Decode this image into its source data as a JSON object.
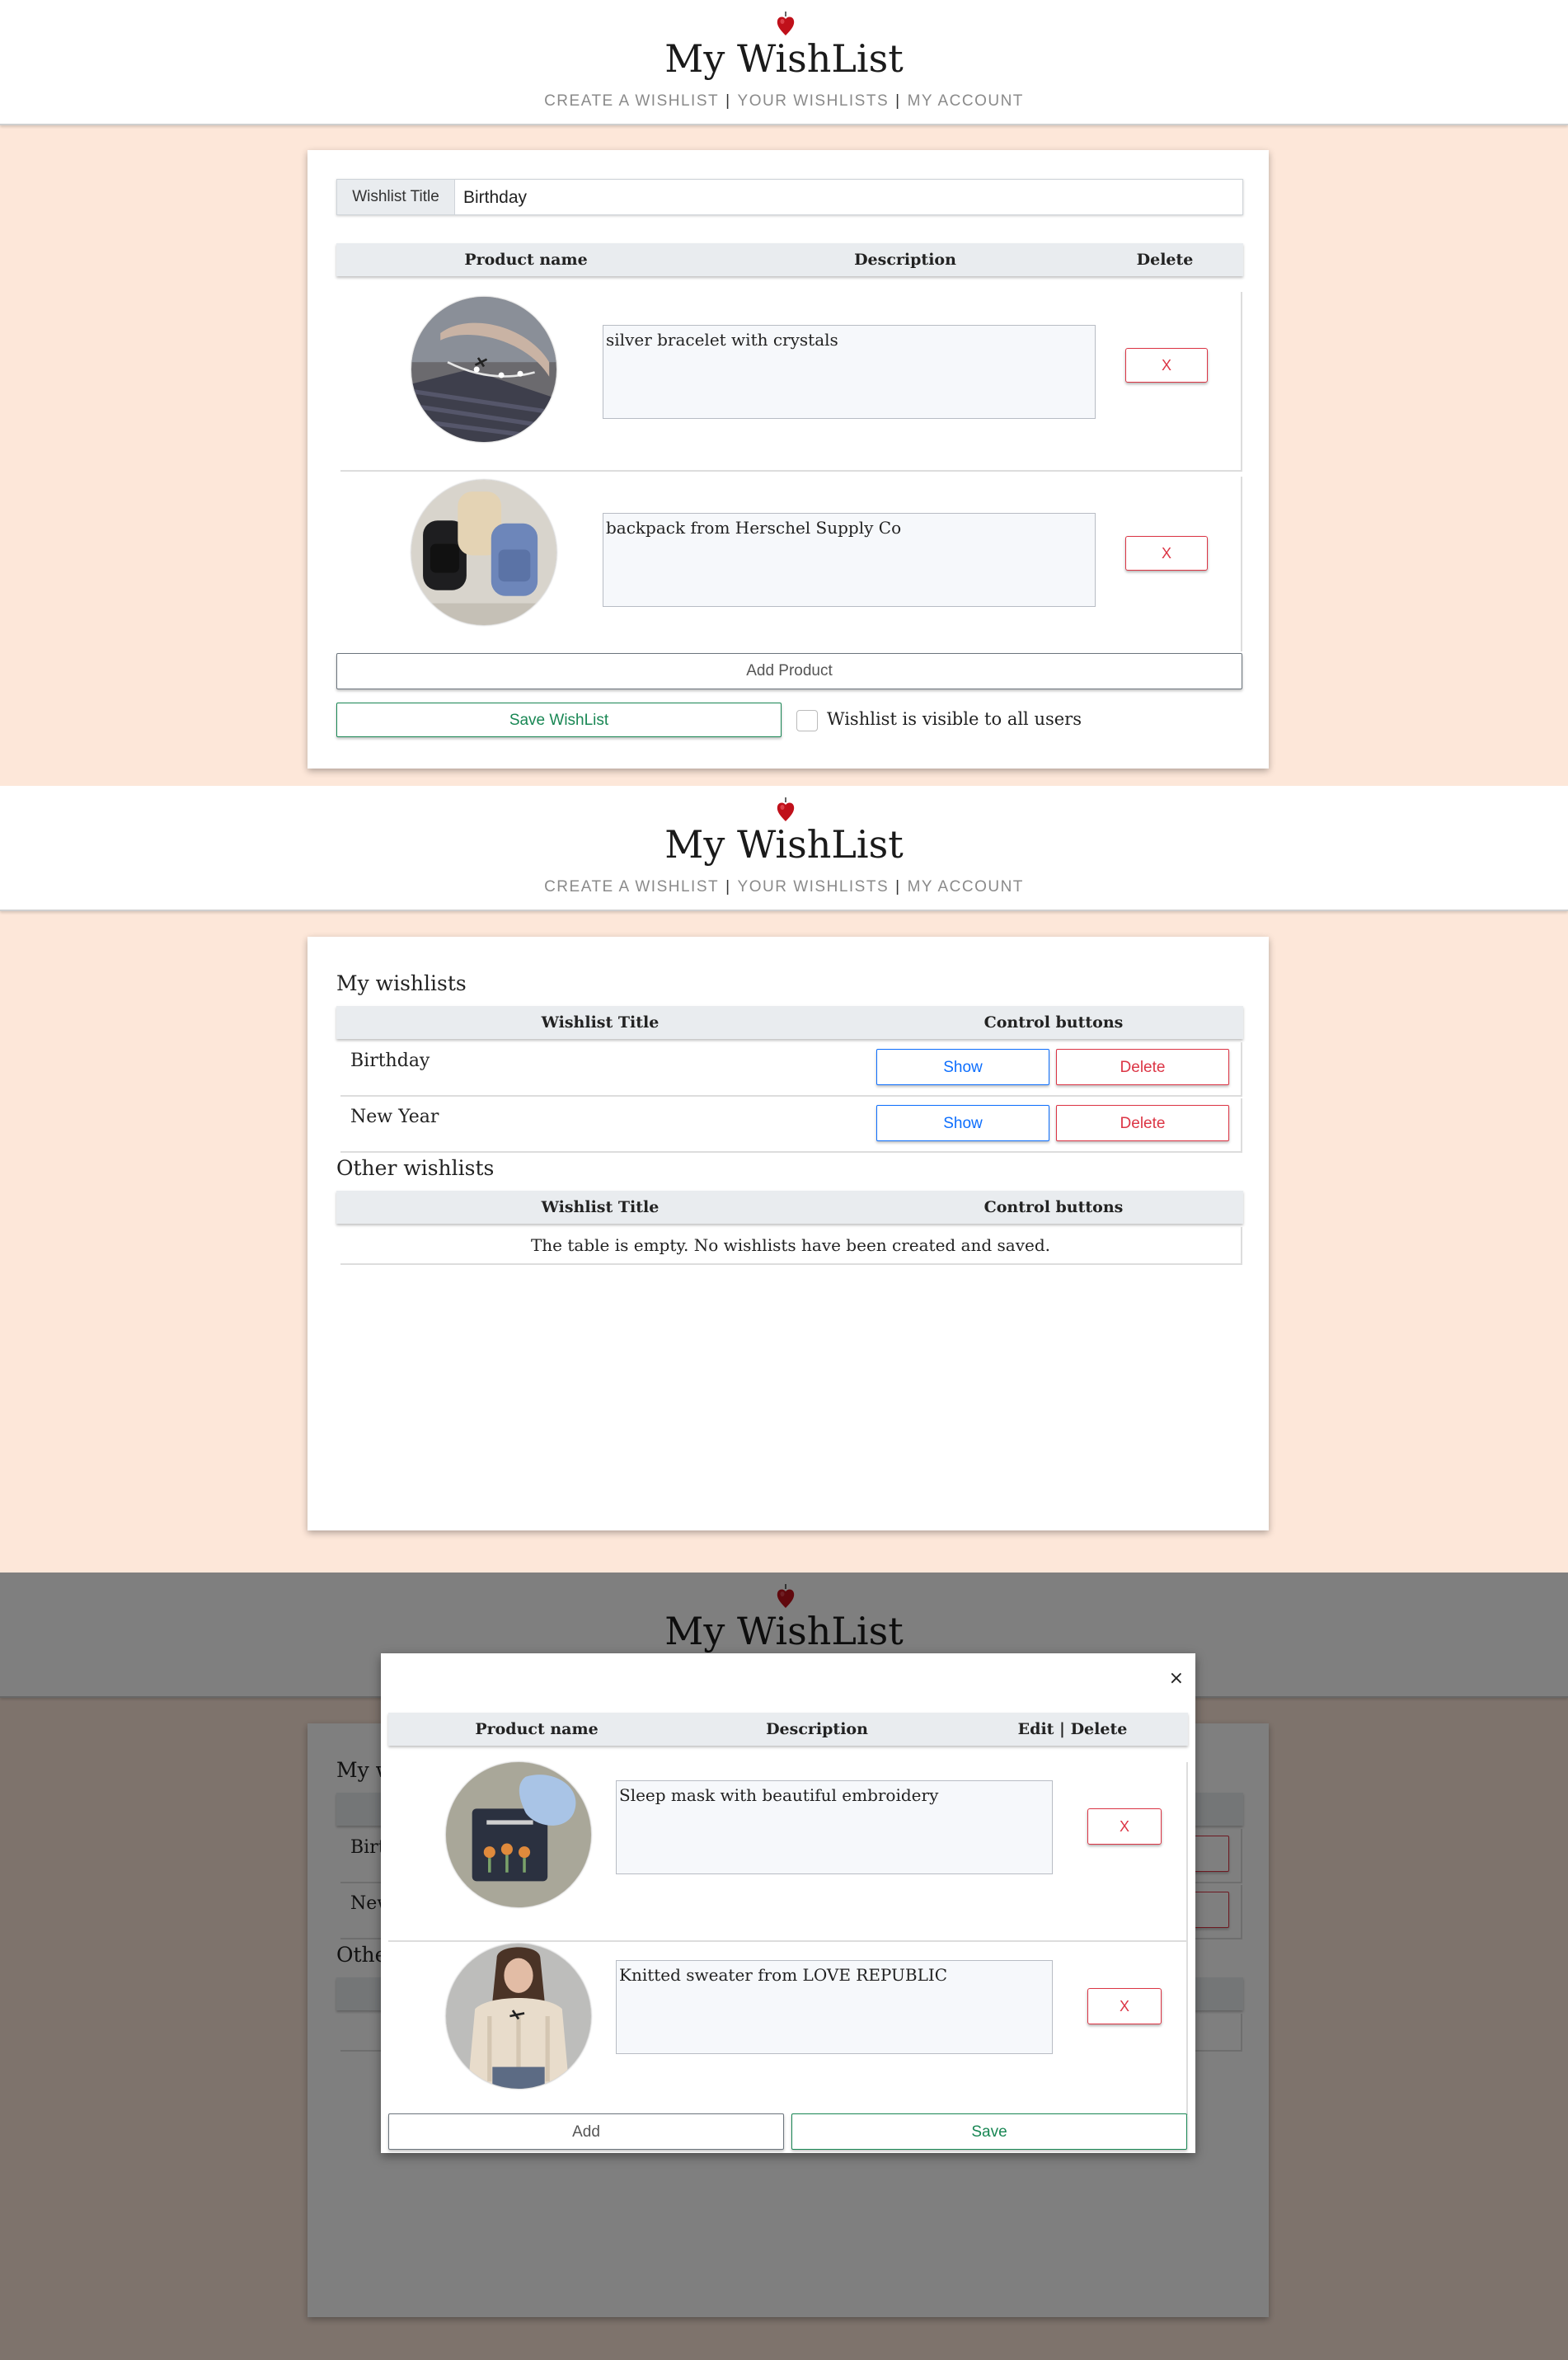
{
  "site": {
    "title": "My WishList",
    "nav": [
      "CREATE A WISHLIST",
      "YOUR WISHLISTS",
      "MY ACCOUNT"
    ]
  },
  "create_view": {
    "title_label": "Wishlist Title",
    "title_value": "Birthday",
    "columns": [
      "Product name",
      "Description",
      "Delete"
    ],
    "products": [
      {
        "image": "bracelet photo",
        "description": "silver bracelet with crystals",
        "delete_label": "X"
      },
      {
        "image": "backpacks photo",
        "description": "backpack from Herschel Supply Co",
        "delete_label": "X"
      }
    ],
    "add_button": "Add Product",
    "save_button": "Save WishList",
    "visible_label": "Wishlist is visible to all users"
  },
  "lists_view": {
    "my_heading": "My wishlists",
    "columns": [
      "Wishlist Title",
      "Control buttons"
    ],
    "my_lists": [
      {
        "title": "Birthday",
        "show": "Show",
        "delete": "Delete"
      },
      {
        "title": "New Year",
        "show": "Show",
        "delete": "Delete"
      }
    ],
    "other_heading": "Other wishlists",
    "other_empty": "The table is empty. No wishlists have been created and saved."
  },
  "modal_view": {
    "close": "×",
    "columns": [
      "Product name",
      "Description",
      "Edit | Delete"
    ],
    "products": [
      {
        "image": "sleep mask photo",
        "description": "Sleep mask with beautiful embroidery",
        "delete_label": "X"
      },
      {
        "image": "sweater photo",
        "description": "Knitted sweater from LOVE REPUBLIC",
        "delete_label": "X"
      }
    ],
    "add_button": "Add",
    "save_button": "Save",
    "background_fragments": [
      "My w",
      "Birt",
      "New",
      "Othe"
    ]
  },
  "colors": {
    "page_bg": "#fde7d9",
    "header_bg": "#ffffff",
    "table_head_bg": "#e9ecef",
    "green": "#198754",
    "blue": "#0d6efd",
    "red": "#dc3545",
    "logo": "#c0101a"
  }
}
